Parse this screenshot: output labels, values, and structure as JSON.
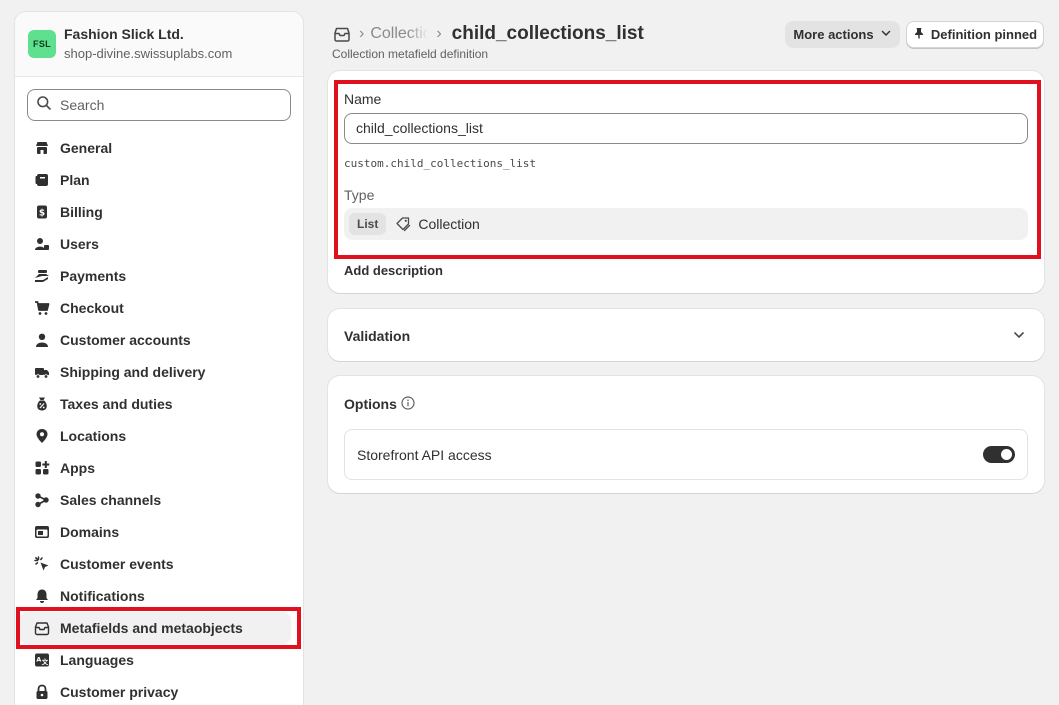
{
  "store": {
    "avatar_text": "FSL",
    "name": "Fashion Slick Ltd.",
    "domain": "shop-divine.swissuplabs.com"
  },
  "search": {
    "placeholder": "Search"
  },
  "nav": {
    "items": [
      {
        "label": "General",
        "icon": "store-icon"
      },
      {
        "label": "Plan",
        "icon": "plan-icon"
      },
      {
        "label": "Billing",
        "icon": "billing-icon"
      },
      {
        "label": "Users",
        "icon": "users-icon"
      },
      {
        "label": "Payments",
        "icon": "payments-icon"
      },
      {
        "label": "Checkout",
        "icon": "cart-icon"
      },
      {
        "label": "Customer accounts",
        "icon": "person-icon"
      },
      {
        "label": "Shipping and delivery",
        "icon": "truck-icon"
      },
      {
        "label": "Taxes and duties",
        "icon": "tax-icon"
      },
      {
        "label": "Locations",
        "icon": "location-icon"
      },
      {
        "label": "Apps",
        "icon": "apps-icon"
      },
      {
        "label": "Sales channels",
        "icon": "channels-icon"
      },
      {
        "label": "Domains",
        "icon": "domains-icon"
      },
      {
        "label": "Customer events",
        "icon": "cursor-icon"
      },
      {
        "label": "Notifications",
        "icon": "bell-icon"
      },
      {
        "label": "Metafields and metaobjects",
        "icon": "metafields-icon"
      },
      {
        "label": "Languages",
        "icon": "languages-icon"
      },
      {
        "label": "Customer privacy",
        "icon": "lock-icon"
      }
    ]
  },
  "header": {
    "breadcrumb_parent": "Collections",
    "breadcrumb_sep": "›",
    "title": "child_collections_list",
    "subtitle": "Collection metafield definition",
    "more_actions": "More actions",
    "pinned": "Definition pinned"
  },
  "definition": {
    "name_label": "Name",
    "name_value": "child_collections_list",
    "namespace_key": "custom.child_collections_list",
    "type_label": "Type",
    "type_badge": "List",
    "type_value": "Collection",
    "add_description": "Add description"
  },
  "validation": {
    "title": "Validation"
  },
  "options": {
    "title": "Options",
    "storefront_label": "Storefront API access",
    "storefront_enabled": true
  },
  "colors": {
    "highlight": "#e0101f",
    "avatar_bg": "#5ee08e",
    "toggle_on": "#303030"
  }
}
